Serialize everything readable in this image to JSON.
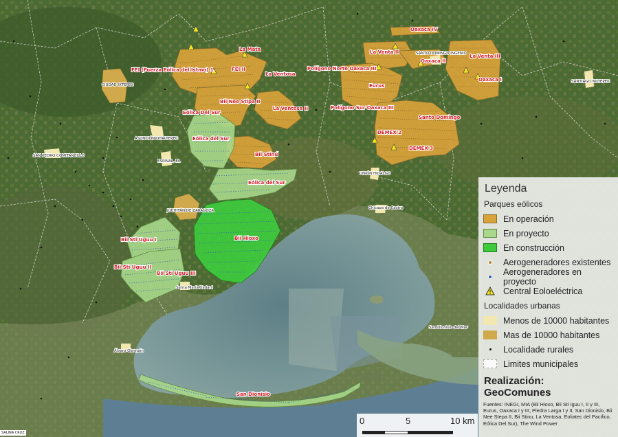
{
  "map": {
    "parks": [
      {
        "label": "FEI (Fuerza Eólica del Istmo)  1",
        "status": "operacion"
      },
      {
        "label": "FEI II",
        "status": "operacion"
      },
      {
        "label": "La Mata",
        "status": "operacion"
      },
      {
        "label": "La Ventosa",
        "status": "operacion"
      },
      {
        "label": "Bii Nee Stipa II",
        "status": "operacion"
      },
      {
        "label": "La Ventosa II",
        "status": "operacion"
      },
      {
        "label": "Eólica Del Sur",
        "status": "proyecto"
      },
      {
        "label": "Eólica del Sur",
        "status": "proyecto"
      },
      {
        "label": "Bii Stinú",
        "status": "operacion"
      },
      {
        "label": "Eólica del Sur",
        "status": "proyecto"
      },
      {
        "label": "Bii Hioxo",
        "status": "construccion"
      },
      {
        "label": "Bii Sti Uguu I",
        "status": "proyecto"
      },
      {
        "label": "Bii Sti Uguu II",
        "status": "proyecto"
      },
      {
        "label": "Bii Sti Uguu III",
        "status": "proyecto"
      },
      {
        "label": "San Dionisio",
        "status": "proyecto"
      },
      {
        "label": "Oaxaca IV",
        "status": "operacion"
      },
      {
        "label": "La Venta II",
        "status": "operacion"
      },
      {
        "label": "Oaxaca II",
        "status": "operacion"
      },
      {
        "label": "La Venta III",
        "status": "operacion"
      },
      {
        "label": "Oaxaca I",
        "status": "operacion"
      },
      {
        "label": "Polígono Norte Oaxaca III",
        "status": "operacion"
      },
      {
        "label": "Eurus",
        "status": "operacion"
      },
      {
        "label": "Polígono Sur Oaxaca III",
        "status": "operacion"
      },
      {
        "label": "Santo Domingo",
        "status": "operacion"
      },
      {
        "label": "DEMEX 2",
        "status": "operacion"
      },
      {
        "label": "DEMEX 3",
        "status": "operacion"
      }
    ],
    "towns": [
      "CIUDAD IXTEPEC",
      "ASUNCIÓN IXTALTEPEC",
      "ESPINAL, EL",
      "SAN PEDRO COMITANCILLO",
      "JUCHITÁN DE ZARAGOZA",
      "SANTO DOMINGO INGENIO",
      "SANTIAGO NILTEPEC",
      "UNIÓN HIDALGO",
      "Chicapa de Castro",
      "Santa María Xadani",
      "Álvaro Obregón",
      "San Dionisio del Mar"
    ],
    "corner_label": "SALINA CRUZ"
  },
  "legend": {
    "title": "Leyenda",
    "section_parks": "Parques eólicos",
    "section_urban": "Localidades urbanas",
    "items": [
      {
        "label": "En operación",
        "color": "#d9a23a"
      },
      {
        "label": "En proyecto",
        "color": "#a8d88b"
      },
      {
        "label": "En construcción",
        "color": "#3ecb3e"
      },
      {
        "label": "Aerogeneradores existentes",
        "color": "#b08a3a"
      },
      {
        "label": "Aerogeneradores en proyecto",
        "color": "#2c5bb5"
      },
      {
        "label": "Central Eoloeléctrica",
        "color": "#f5e61c"
      },
      {
        "label": "Menos de 10000 habitantes",
        "color": "#f3e7b0"
      },
      {
        "label": "Mas de 10000 habitantes",
        "color": "#cfa94c"
      },
      {
        "label": "Localidade rurales",
        "color": "#111111"
      },
      {
        "label": "Limites municipales",
        "color": "#dddddd"
      }
    ],
    "credit": "Realización: GeoComunes",
    "sources": "Fuentes: INEGI, MIA (Bii Hioxo, Bii Sti Iguu I, II y III, Eurus, Oaxaca I y III, Piedra Larga I y II, San Dionisio, Bii Nee Stepa II, Bii Stinu, La Ventosa, Eoliatec del Pacifico, Eólica Del Sur), The Wind Power"
  },
  "scale": {
    "t0": "0",
    "t1": "5",
    "t2": "10 km"
  }
}
